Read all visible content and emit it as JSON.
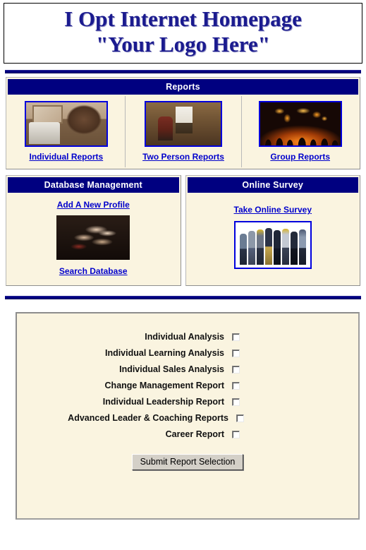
{
  "header": {
    "title_line1": "I Opt Internet Homepage",
    "title_line2": "\"Your Logo Here\""
  },
  "reports_section": {
    "heading": "Reports",
    "items": [
      {
        "label": "Individual Reports",
        "image": "man-at-desk-photo"
      },
      {
        "label": "Two Person Reports",
        "image": "two-people-warehouse-photo"
      },
      {
        "label": "Group Reports",
        "image": "world-map-crowd-photo"
      }
    ]
  },
  "database_panel": {
    "heading": "Database Management",
    "add_profile_label": "Add A New Profile",
    "image": "joined-hands-photo",
    "search_label": "Search Database"
  },
  "survey_panel": {
    "heading": "Online Survey",
    "take_survey_label": "Take Online Survey",
    "image": "group-of-workers-photo"
  },
  "report_form": {
    "checkboxes": [
      {
        "label": "Individual Analysis",
        "checked": false
      },
      {
        "label": "Individual Learning Analysis",
        "checked": false
      },
      {
        "label": "Individual Sales Analysis",
        "checked": false
      },
      {
        "label": "Change Management Report",
        "checked": false
      },
      {
        "label": "Individual Leadership Report",
        "checked": false
      },
      {
        "label": "Advanced Leader & Coaching Reports",
        "checked": false
      },
      {
        "label": "Career Report",
        "checked": false
      }
    ],
    "submit_label": "Submit Report Selection"
  },
  "colors": {
    "navy": "#000080",
    "cream": "#faf4e0",
    "link_blue": "#0000cc",
    "title_blue": "#1b1b8f",
    "button_face": "#d4d0c8"
  }
}
